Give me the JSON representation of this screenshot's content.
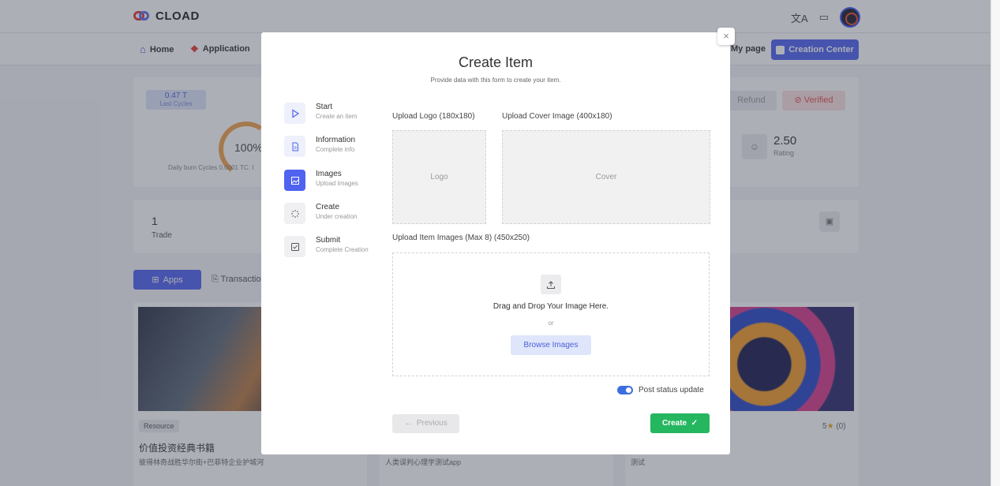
{
  "app": {
    "brand": "CLOAD"
  },
  "nav": {
    "home": "Home",
    "application": "Application",
    "my_page": "My page",
    "creation_center": "Creation Center"
  },
  "stats": {
    "cycles_value": "0.47 T",
    "cycles_label": "Last Cycles",
    "gauge_percent": "100%",
    "daily_burn": "Daily burn Cycles 0.0001 TC. I",
    "refund": "Refund",
    "verified": "Verified",
    "rating_value": "2.50",
    "rating_label": "Rating"
  },
  "trade": {
    "count": "1",
    "label": "Trade"
  },
  "tabs": {
    "apps": "Apps",
    "transactions": "Transactio"
  },
  "apps": [
    {
      "badge": "Resource",
      "title": "价值投资经典书籍",
      "desc": "彼得林奇战胜华尔街+巴菲特企业护城河"
    },
    {
      "desc": "人类误判心理学测试app"
    },
    {
      "stars": "5",
      "reviews": "(0)",
      "desc": "测试"
    }
  ],
  "modal": {
    "title": "Create Item",
    "subtitle": "Provide data with this form to create your item.",
    "close": "×",
    "steps": [
      {
        "name": "Start",
        "desc": "Create an item"
      },
      {
        "name": "Information",
        "desc": "Complete info"
      },
      {
        "name": "Images",
        "desc": "Upload Images"
      },
      {
        "name": "Create",
        "desc": "Under creation"
      },
      {
        "name": "Submit",
        "desc": "Complete Creation"
      }
    ],
    "logo_label": "Upload Logo (180x180)",
    "logo_placeholder": "Logo",
    "cover_label": "Upload Cover Image (400x180)",
    "cover_placeholder": "Cover",
    "images_label": "Upload Item Images (Max 8) (450x250)",
    "drop_text": "Drag and Drop Your Image Here.",
    "or_text": "or",
    "browse_button": "Browse Images",
    "toggle_label": "Post status update",
    "toggle_on": true,
    "previous_button": "Previous",
    "create_button": "Create"
  }
}
